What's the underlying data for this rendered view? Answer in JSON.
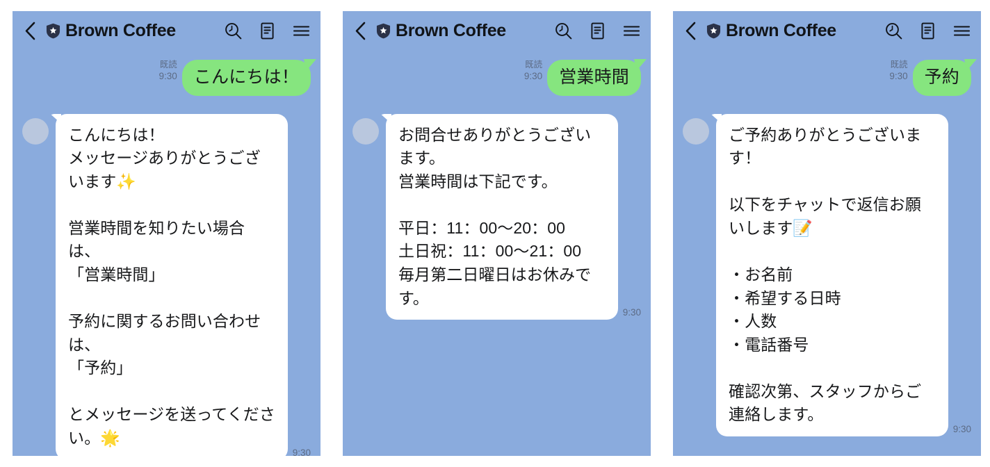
{
  "app": {
    "background_color": "#8aabdd",
    "outgoing_bubble_color": "#86e57f",
    "incoming_bubble_color": "#ffffff",
    "meta_text_color": "#5c6b85",
    "panel_count": 3
  },
  "header": {
    "back_icon": "back-chevron-icon",
    "badge_icon": "verified-shield-star-icon",
    "account_name": "Brown Coffee",
    "actions": [
      {
        "icon": "search-clock-icon",
        "name": "search-button"
      },
      {
        "icon": "note-document-icon",
        "name": "notes-button"
      },
      {
        "icon": "hamburger-menu-icon",
        "name": "menu-button"
      }
    ]
  },
  "panels": [
    {
      "id": "panel-greeting",
      "header": {
        "account_name": "Brown Coffee"
      },
      "outgoing": {
        "read_label": "既読",
        "time": "9:30",
        "text": "こんにちは！"
      },
      "incoming": {
        "time": "9:30",
        "text": "こんにちは！\nメッセージありがとうございます✨\n\n営業時間を知りたい場合は、\n「営業時間」\n\n予約に関するお問い合わせは、\n「予約」\n\nとメッセージを送ってください。🌟"
      }
    },
    {
      "id": "panel-business-hours",
      "header": {
        "account_name": "Brown Coffee"
      },
      "outgoing": {
        "read_label": "既読",
        "time": "9:30",
        "text": "営業時間"
      },
      "incoming": {
        "time": "9:30",
        "text": "お問合せありがとうございます。\n営業時間は下記です。\n\n平日：11：00〜20：00\n土日祝：11：00〜21：00\n毎月第二日曜日はお休みです。"
      }
    },
    {
      "id": "panel-reservation",
      "header": {
        "account_name": "Brown Coffee"
      },
      "outgoing": {
        "read_label": "既読",
        "time": "9:30",
        "text": "予約"
      },
      "incoming": {
        "time": "9:30",
        "text": "ご予約ありがとうございます！\n\n以下をチャットで返信お願いします📝\n\n・お名前\n・希望する日時\n・人数\n・電話番号\n\n確認次第、スタッフからご連絡します。"
      }
    }
  ]
}
